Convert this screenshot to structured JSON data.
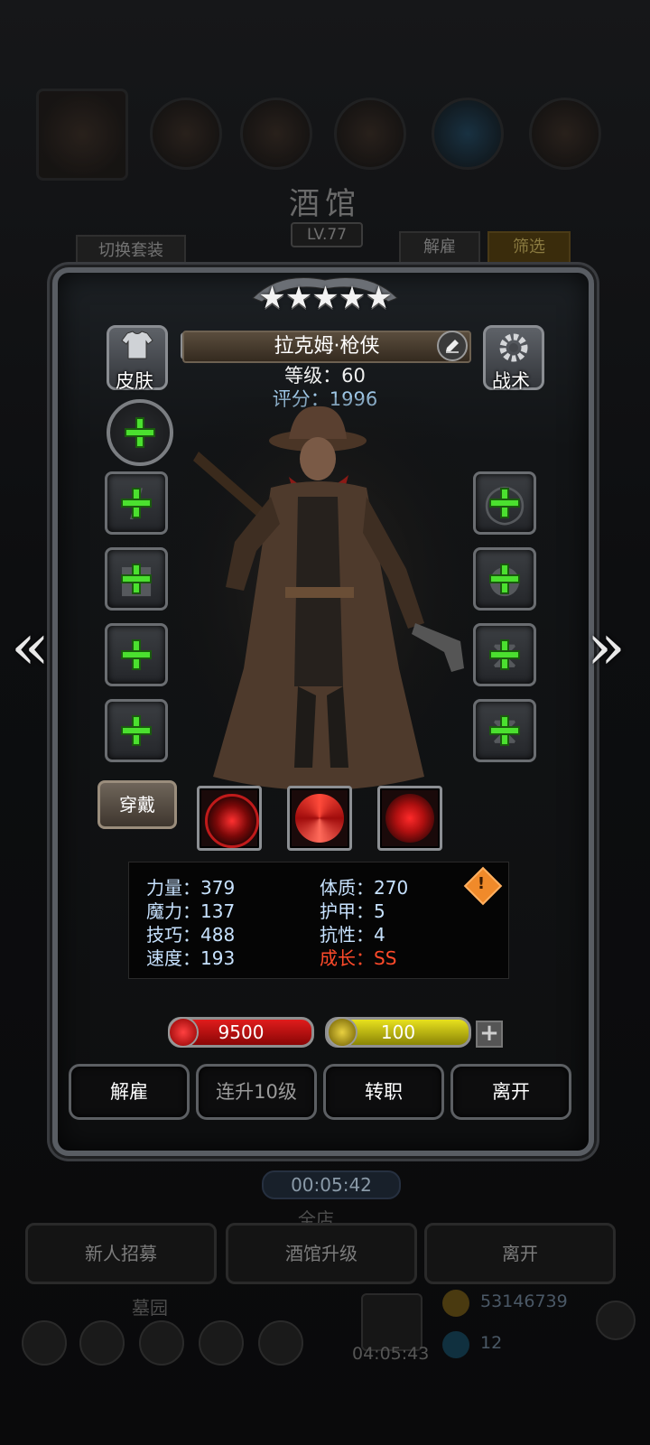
{
  "background": {
    "title": "酒馆",
    "level_badge": "LV.77",
    "switch_outfit": "切换套装",
    "dismiss": "解雇",
    "filter": "筛选",
    "timer": "00:05:42",
    "section_label": "全店",
    "bottom_buttons": [
      "新人招募",
      "酒馆升级",
      "离开"
    ],
    "graveyard_label": "墓园",
    "gift_timer": "04:05:43",
    "gold_amount": "53146739",
    "gem_amount": "12"
  },
  "hero": {
    "stars": "★★★★★",
    "star_count": 5,
    "name": "拉克姆·枪侠",
    "level": "等级：60",
    "score": "评分：1996"
  },
  "corner_buttons": {
    "skin": "皮肤",
    "tactics": "战术"
  },
  "wear_button": "穿戴",
  "stats": {
    "strength": "力量：379",
    "magic": "魔力：137",
    "skill": "技巧：488",
    "speed": "速度：193",
    "constitution": "体质：270",
    "armor": "护甲：5",
    "resistance": "抗性：4",
    "growth": "成长：SS"
  },
  "bars": {
    "hp": "9500",
    "energy": "100"
  },
  "actions": {
    "dismiss": "解雇",
    "level_up_10": "连升10级",
    "change_job": "转职",
    "leave": "离开"
  },
  "colors": {
    "plus_green": "#4be02f",
    "hp_red": "#e01c1c",
    "energy_yellow": "#e8e11e",
    "score_blue": "#9ec7e6",
    "growth_red": "#ff4a2a"
  }
}
